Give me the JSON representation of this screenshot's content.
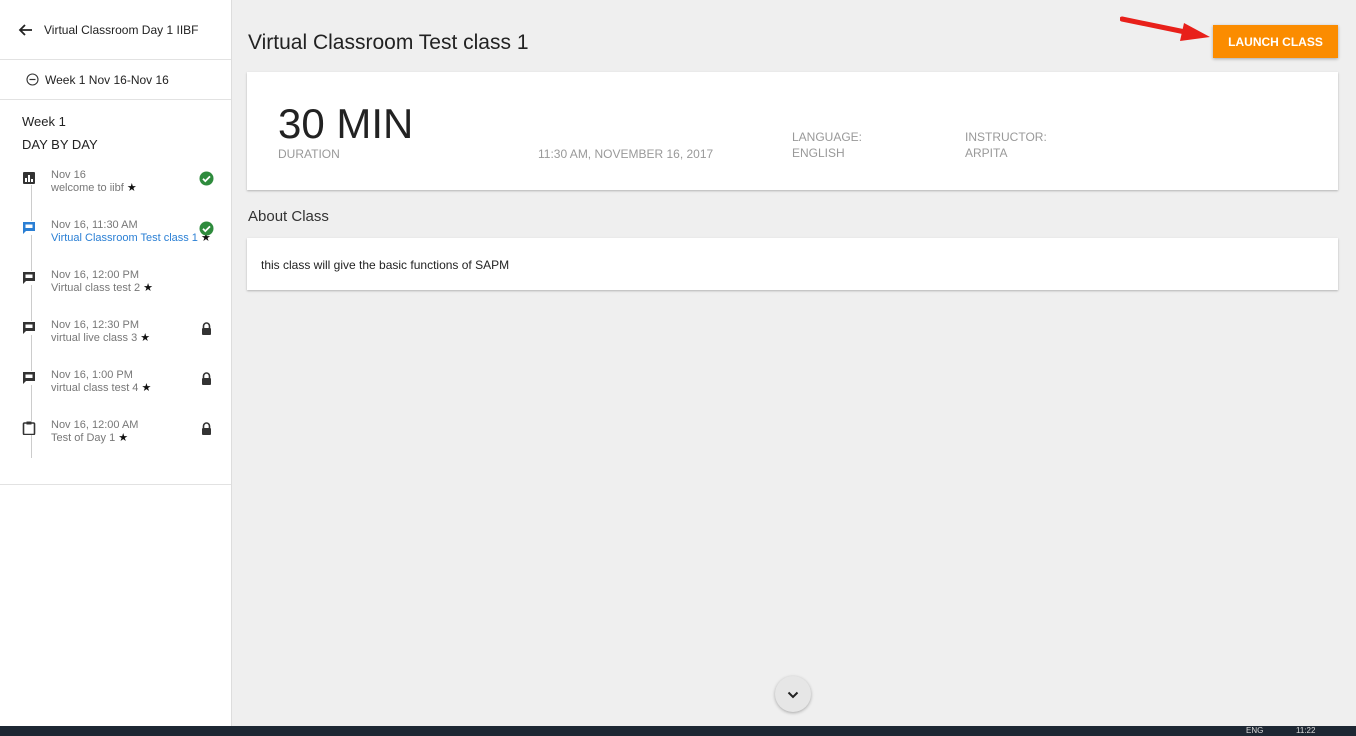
{
  "sidebar": {
    "back_label": "Virtual Classroom Day 1 IIBF",
    "week_label": "Week 1 Nov 16-Nov 16",
    "section_week": "Week 1",
    "section_day": "DAY BY DAY",
    "items": [
      {
        "time": "Nov 16",
        "title": "welcome to iibf",
        "star": "★",
        "icon": "bar-chart-icon",
        "status": "completed"
      },
      {
        "time": "Nov 16, 11:30 AM",
        "title": "Virtual Classroom Test class 1",
        "star": "★",
        "icon": "chat-icon",
        "status": "completed",
        "active": true
      },
      {
        "time": "Nov 16, 12:00 PM",
        "title": "Virtual class test 2",
        "star": "★",
        "icon": "chat-icon",
        "status": "none"
      },
      {
        "time": "Nov 16, 12:30 PM",
        "title": "virtual live class 3",
        "star": "★",
        "icon": "chat-icon",
        "status": "locked"
      },
      {
        "time": "Nov 16, 1:00 PM",
        "title": "virtual class test 4",
        "star": "★",
        "icon": "chat-icon",
        "status": "locked"
      },
      {
        "time": "Nov 16, 12:00 AM",
        "title": "Test of Day 1",
        "star": "★",
        "icon": "clipboard-icon",
        "status": "locked"
      }
    ]
  },
  "main": {
    "title": "Virtual Classroom Test class 1",
    "launch_label": "LAUNCH CLASS",
    "duration_value": "30 MIN",
    "duration_label": "DURATION",
    "datetime": "11:30 AM, NOVEMBER 16, 2017",
    "language_label": "LANGUAGE:",
    "language_value": "ENGLISH",
    "instructor_label": "INSTRUCTOR:",
    "instructor_value": "ARPITA",
    "about_heading": "About Class",
    "about_text": "this class will give the basic functions of SAPM"
  },
  "taskbar": {
    "lang": "ENG",
    "clock": "11:22"
  },
  "colors": {
    "accent": "#fb8c00",
    "link": "#2a7fd4",
    "success": "#2e8b3d",
    "annotation_arrow": "#e8201a"
  }
}
